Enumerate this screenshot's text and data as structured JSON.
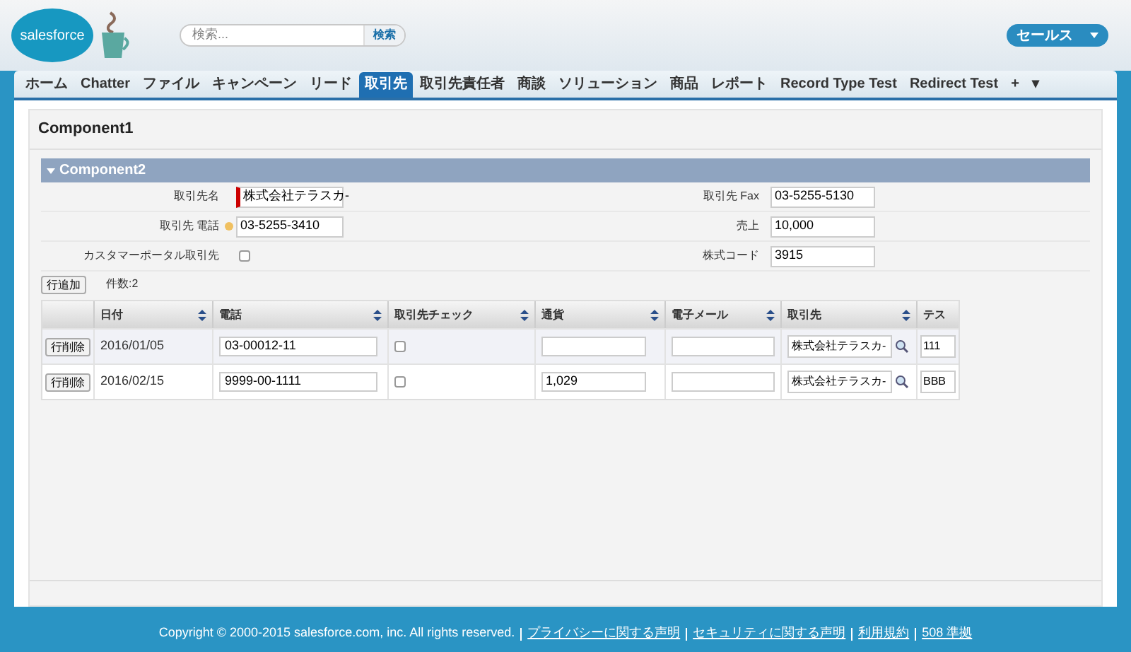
{
  "header": {
    "logo": "salesforce",
    "search": {
      "placeholder": "検索...",
      "button": "検索"
    },
    "app_menu": "セールス"
  },
  "tabs": [
    {
      "label": "ホーム",
      "selected": false
    },
    {
      "label": "Chatter",
      "selected": false
    },
    {
      "label": "ファイル",
      "selected": false
    },
    {
      "label": "キャンペーン",
      "selected": false
    },
    {
      "label": "リード",
      "selected": false
    },
    {
      "label": "取引先",
      "selected": true
    },
    {
      "label": "取引先責任者",
      "selected": false
    },
    {
      "label": "商談",
      "selected": false
    },
    {
      "label": "ソリューション",
      "selected": false
    },
    {
      "label": "商品",
      "selected": false
    },
    {
      "label": "レポート",
      "selected": false
    },
    {
      "label": "Record Type Test",
      "selected": false
    },
    {
      "label": "Redirect Test",
      "selected": false
    },
    {
      "label": "+",
      "selected": false
    },
    {
      "label": "▾",
      "selected": false
    }
  ],
  "page_title": "Component1",
  "section": {
    "title": "Component2",
    "expanded": true,
    "left_fields": [
      {
        "kind": "text",
        "label": "取引先名",
        "value": "株式会社テラスカ-",
        "required": true,
        "help": false
      },
      {
        "kind": "text",
        "label": "取引先 電話",
        "value": "03-5255-3410",
        "required": false,
        "help": true
      },
      {
        "kind": "checkbox",
        "label": "カスタマーポータル取引先",
        "checked": false
      }
    ],
    "right_fields": [
      {
        "kind": "text",
        "label": "取引先 Fax",
        "value": "03-5255-5130"
      },
      {
        "kind": "text",
        "label": "売上",
        "value": "10,000"
      },
      {
        "kind": "text",
        "label": "株式コード",
        "value": "3915"
      }
    ]
  },
  "table": {
    "add_button": "行追加",
    "count": "件数:2",
    "columns": [
      "日付",
      "電話",
      "取引先チェック",
      "通貨",
      "電子メール",
      "取引先",
      "テス"
    ],
    "rows": [
      {
        "delete_button": "行削除",
        "date": "2016/01/05",
        "phone": "03-00012-11",
        "checked": false,
        "currency": "",
        "email": "",
        "account": "株式会社テラスカ-",
        "column_7": "111"
      },
      {
        "delete_button": "行削除",
        "date": "2016/02/15",
        "phone": "9999-00-1111",
        "checked": false,
        "currency": "1,029",
        "email": "",
        "account": "株式会社テラスカ-",
        "column_7": "BBB"
      }
    ]
  },
  "footer": {
    "copyright": "Copyright © 2000-2015 salesforce.com, inc. All rights reserved.",
    "links": [
      "プライバシーに関する声明",
      "セキュリティに関する声明",
      "利用規約",
      "508 準拠"
    ]
  }
}
